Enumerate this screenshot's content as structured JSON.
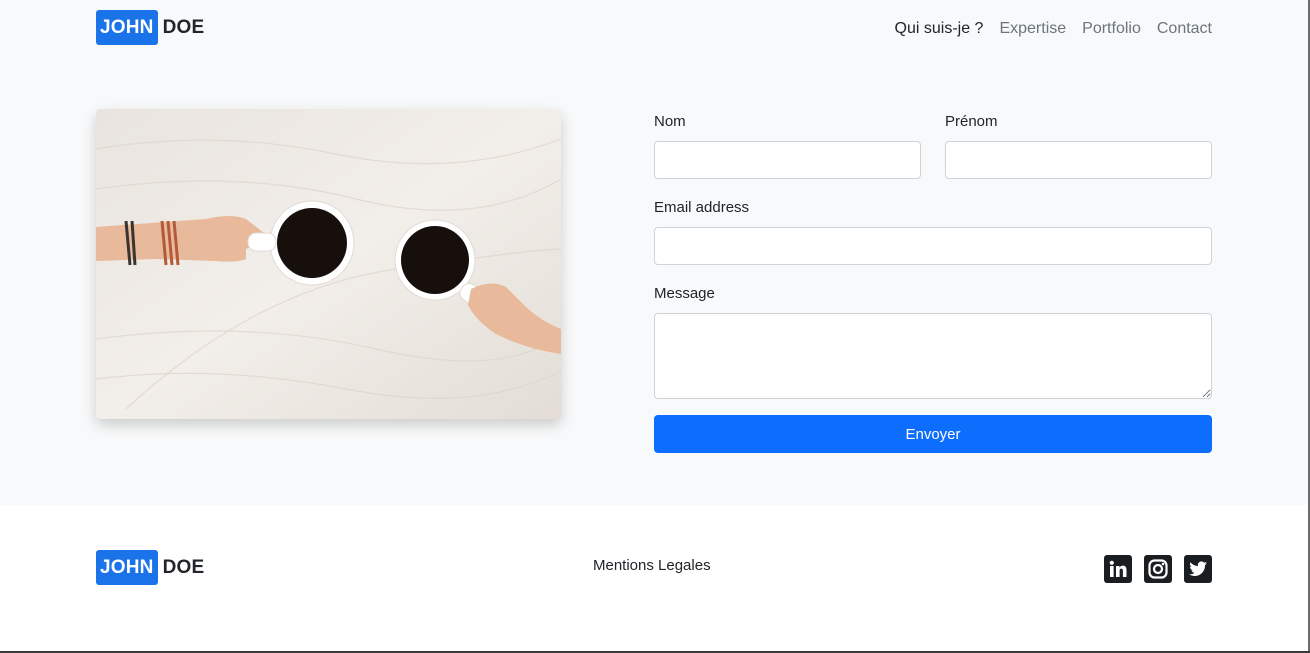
{
  "header": {
    "logo": {
      "first": "JOHN",
      "last": "DOE"
    },
    "nav": [
      {
        "label": "Qui suis-je ?",
        "active": true
      },
      {
        "label": "Expertise",
        "active": false
      },
      {
        "label": "Portfolio",
        "active": false
      },
      {
        "label": "Contact",
        "active": false
      }
    ]
  },
  "contact_form": {
    "nom_label": "Nom",
    "nom_value": "",
    "prenom_label": "Prénom",
    "prenom_value": "",
    "email_label": "Email address",
    "email_value": "",
    "message_label": "Message",
    "message_value": "",
    "submit_label": "Envoyer"
  },
  "footer": {
    "logo": {
      "first": "JOHN",
      "last": "DOE"
    },
    "legal_link": "Mentions Legales",
    "socials": [
      "linkedin-icon",
      "instagram-icon",
      "twitter-icon"
    ]
  },
  "colors": {
    "accent": "#0d6efd",
    "logo_badge": "#1a73e8",
    "page_bg": "#f8f9fa",
    "footer_bg": "#ffffff"
  }
}
